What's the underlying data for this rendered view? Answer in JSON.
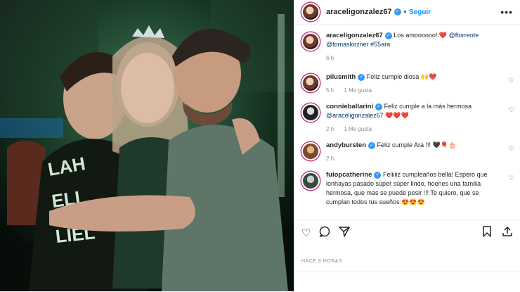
{
  "post": {
    "username": "araceligonzalez67",
    "follow": "Seguir",
    "more": "•••",
    "caption": {
      "username": "araceligonzalez67",
      "text": "Los amoooooo! ❤️",
      "mention1": "@ftorrente",
      "mention2": "@tomaskirzner",
      "hashtag": "#55ara",
      "time": "6 h"
    },
    "comments": [
      {
        "username": "pilusmith",
        "text": "Feliz cumple diosa 🙌❤️",
        "time": "5 h",
        "likes": "1 Me gusta"
      },
      {
        "username": "connieballarini",
        "text": "Feliz cumple a la más hermosa",
        "mention": "@araceligonzalez67",
        "emoji": "❤️❤️❤️",
        "time": "2 h",
        "likes": "1 Me gusta"
      },
      {
        "username": "andybursten",
        "text": "Feliz cumple Ara !!! 🖤🎈🎂",
        "time": "2 h"
      },
      {
        "username": "fulopcatherine",
        "text": "Feliiiiz cumpleaños bella! Espero que lonhayas pasado súper súper lindo, hoenes una familia hermosa, que mas se puede pesir !!! Te quiero, que se cumplan todos tus sueños 😍😍😍"
      }
    ],
    "timestamp": "HACE 6 HORAS"
  }
}
